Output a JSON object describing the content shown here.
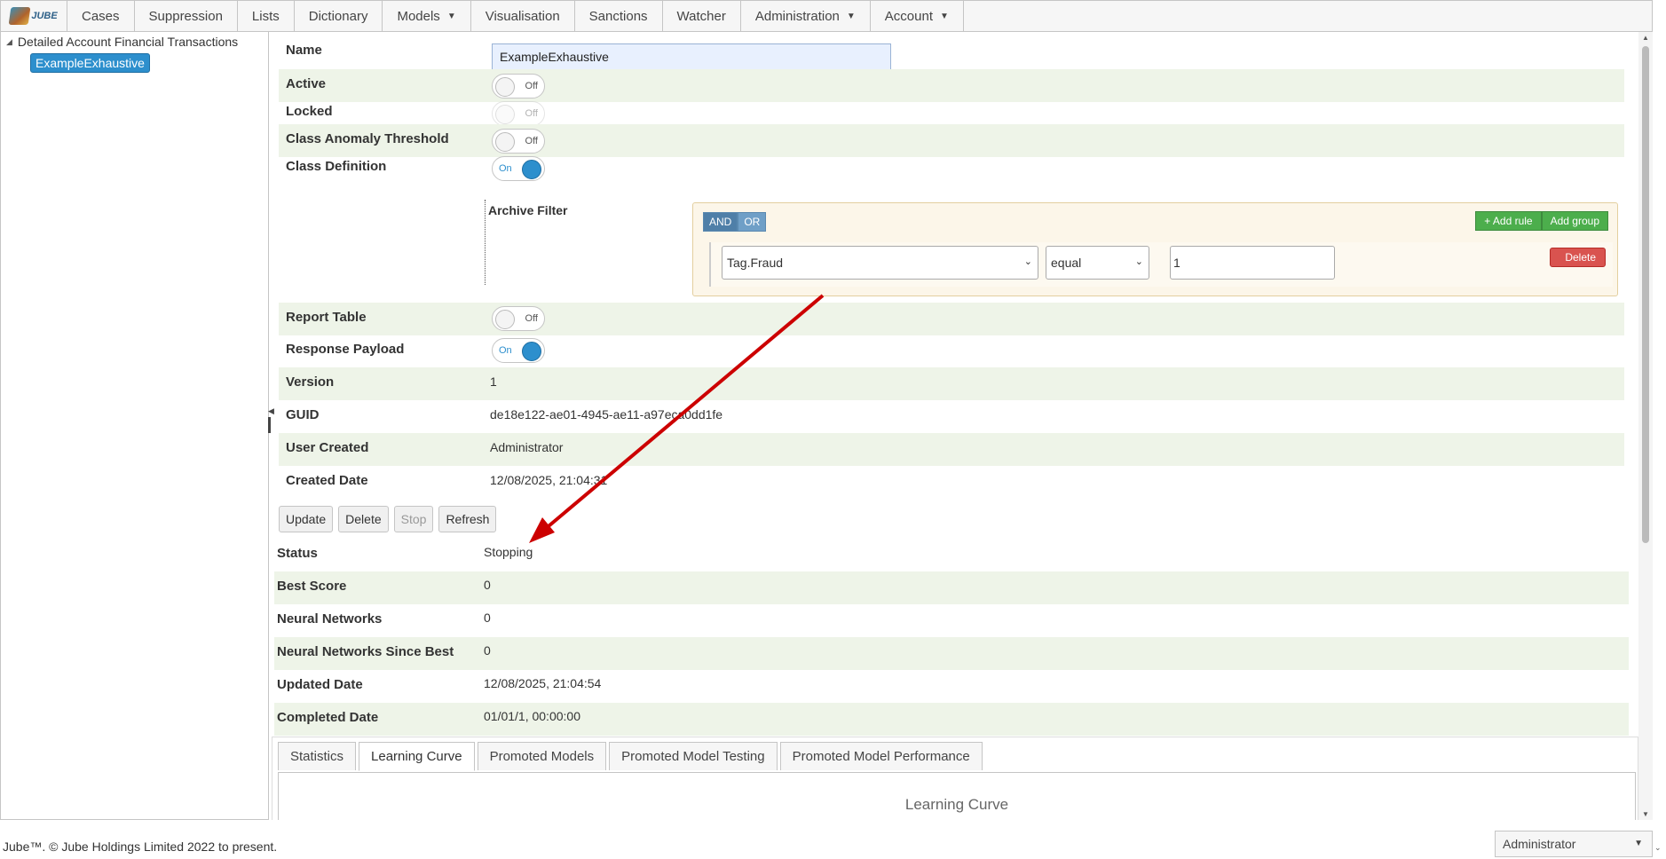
{
  "nav": {
    "logo_text": "JUBE",
    "items": [
      "Cases",
      "Suppression",
      "Lists",
      "Dictionary",
      "Models",
      "Visualisation",
      "Sanctions",
      "Watcher",
      "Administration",
      "Account"
    ]
  },
  "tree": {
    "root": "Detailed Account Financial Transactions",
    "leaf": "ExampleExhaustive"
  },
  "form": {
    "name_label": "Name",
    "name_value": "ExampleExhaustive",
    "active_label": "Active",
    "locked_label": "Locked",
    "class_anomaly_label": "Class Anomaly Threshold",
    "class_definition_label": "Class Definition",
    "archive_filter_label": "Archive Filter",
    "report_table_label": "Report Table",
    "response_payload_label": "Response Payload",
    "version_label": "Version",
    "version_value": "1",
    "guid_label": "GUID",
    "guid_value": "de18e122-ae01-4945-ae11-a97eca0dd1fe",
    "user_created_label": "User Created",
    "user_created_value": "Administrator",
    "created_date_label": "Created Date",
    "created_date_value": "12/08/2025, 21:04:31",
    "toggle_off": "Off",
    "toggle_on": "On"
  },
  "query_builder": {
    "and": "AND",
    "or": "OR",
    "add_rule": "+ Add rule",
    "add_group": "Add group",
    "field": "Tag.Fraud",
    "operator": "equal",
    "value": "1",
    "delete": "Delete"
  },
  "actions": {
    "update": "Update",
    "delete": "Delete",
    "stop": "Stop",
    "refresh": "Refresh"
  },
  "status": {
    "status_label": "Status",
    "status_value": "Stopping",
    "best_score_label": "Best Score",
    "best_score_value": "0",
    "nn_label": "Neural Networks",
    "nn_value": "0",
    "nn_since_label": "Neural Networks Since Best",
    "nn_since_value": "0",
    "updated_label": "Updated Date",
    "updated_value": "12/08/2025, 21:04:54",
    "completed_label": "Completed Date",
    "completed_value": "01/01/1, 00:00:00"
  },
  "tabs": {
    "items": [
      "Statistics",
      "Learning Curve",
      "Promoted Models",
      "Promoted Model Testing",
      "Promoted Model Performance"
    ],
    "active": "Learning Curve",
    "panel_title": "Learning Curve"
  },
  "footer": {
    "copyright": "Jube™. © Jube Holdings Limited 2022 to present.",
    "user": "Administrator"
  },
  "colors": {
    "accent": "#2d8fcd",
    "row_shade": "#eef4e8",
    "arrow": "#cc0000"
  }
}
